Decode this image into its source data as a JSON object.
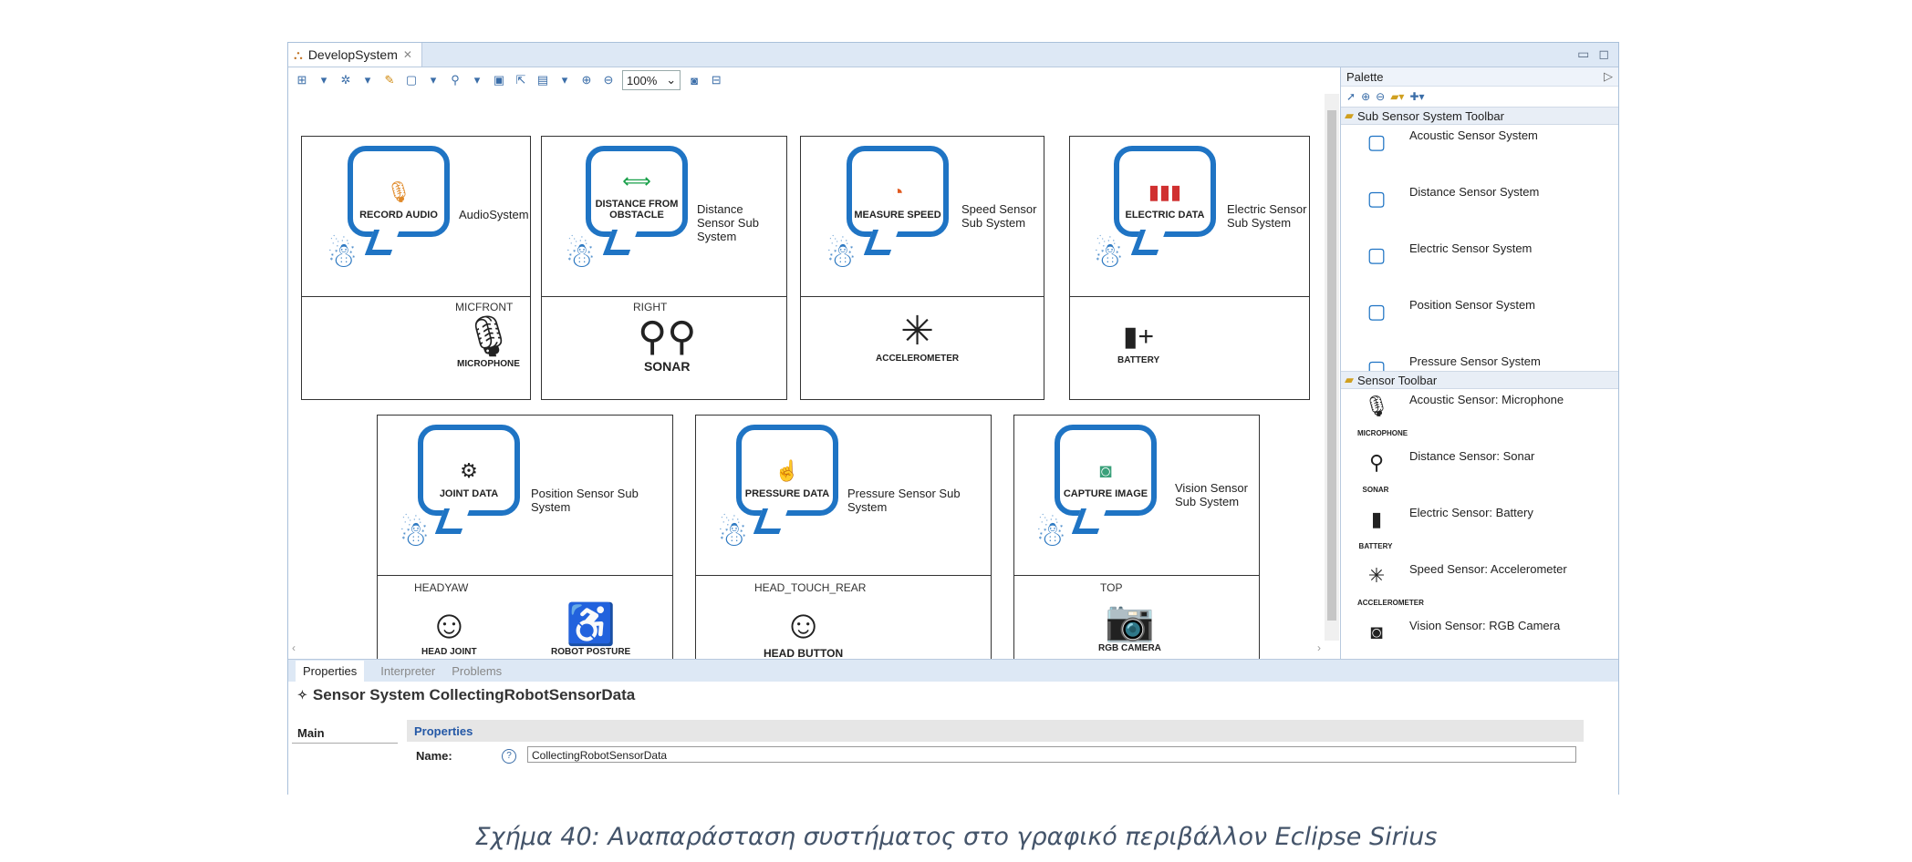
{
  "editor": {
    "tab_label": "DevelopSystem",
    "zoom": "100%"
  },
  "subsystems": [
    {
      "bubble": "RECORD AUDIO",
      "name": "AudioSystem",
      "port": "MICFRONT",
      "sensors": [
        "MICROPHONE"
      ]
    },
    {
      "bubble": "DISTANCE FROM OBSTACLE",
      "name": "Distance Sensor Sub System",
      "port": "RIGHT",
      "sensors": [
        "SONAR"
      ]
    },
    {
      "bubble": "MEASURE SPEED",
      "name": "Speed Sensor Sub System",
      "port": "",
      "sensors": [
        "ACCELEROMETER"
      ]
    },
    {
      "bubble": "ELECTRIC DATA",
      "name": "Electric Sensor Sub System",
      "port": "",
      "sensors": [
        "BATTERY"
      ]
    },
    {
      "bubble": "JOINT DATA",
      "name": "Position Sensor Sub System",
      "port": "HEADYAW",
      "sensors": [
        "HEAD JOINT",
        "ROBOT POSTURE"
      ]
    },
    {
      "bubble": "PRESSURE DATA",
      "name": "Pressure Sensor Sub System",
      "port": "HEAD_TOUCH_REAR",
      "sensors": [
        "HEAD BUTTON"
      ]
    },
    {
      "bubble": "CAPTURE IMAGE",
      "name": "Vision Sensor Sub System",
      "port": "TOP",
      "sensors": [
        "RGB CAMERA"
      ]
    }
  ],
  "palette": {
    "title": "Palette",
    "drawer1": "Sub Sensor System Toolbar",
    "drawer1_items": [
      "Acoustic Sensor System",
      "Distance Sensor System",
      "Electric Sensor System",
      "Position Sensor System",
      "Pressure Sensor System"
    ],
    "drawer2": "Sensor Toolbar",
    "drawer2_items": [
      "Acoustic Sensor: Microphone",
      "Distance Sensor: Sonar",
      "Electric Sensor: Battery",
      "Speed Sensor: Accelerometer",
      "Vision Sensor: RGB Camera"
    ],
    "drawer2_small": [
      "MICROPHONE",
      "SONAR",
      "BATTERY",
      "ACCELEROMETER",
      ""
    ]
  },
  "properties": {
    "tabs": [
      "Properties",
      "Interpreter",
      "Problems"
    ],
    "title": "Sensor System CollectingRobotSensorData",
    "side_tab": "Main",
    "section": "Properties",
    "name_label": "Name:",
    "name_value": "CollectingRobotSensorData"
  },
  "caption": "Σχήμα 40: Αναπαράσταση συστήματος στο γραφικό περιβάλλον Eclipse Sirius"
}
